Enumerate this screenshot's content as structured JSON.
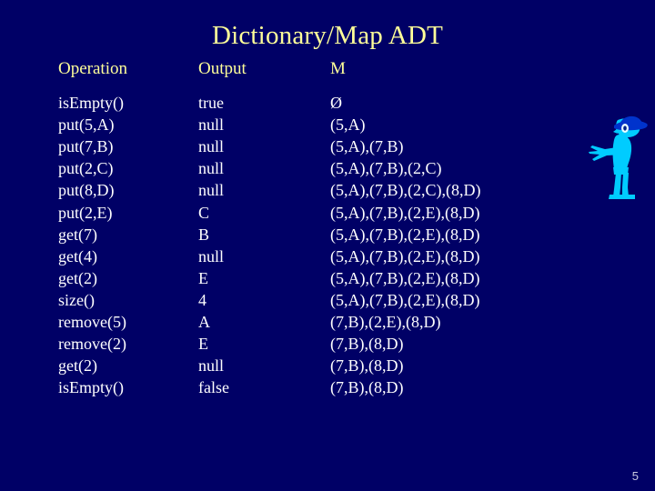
{
  "slide": {
    "title": "Dictionary/Map ADT",
    "page_number": "5",
    "background_color": "#000066",
    "title_color": "#FFFF99",
    "header_color": "#FFFF99",
    "body_color": "#FFFFFF",
    "mascot_color": "#00CCFF",
    "mascot_hat_color": "#0033CC"
  },
  "table": {
    "headers": {
      "operation": "Operation",
      "output": "Output",
      "m": "M"
    },
    "rows": [
      {
        "operation": "isEmpty()",
        "output": "true",
        "m": "Ø"
      },
      {
        "operation": "put(5,A)",
        "output": "null",
        "m": "(5,A)"
      },
      {
        "operation": "put(7,B)",
        "output": "null",
        "m": "(5,A),(7,B)"
      },
      {
        "operation": "put(2,C)",
        "output": "null",
        "m": "(5,A),(7,B),(2,C)"
      },
      {
        "operation": "put(8,D)",
        "output": "null",
        "m": "(5,A),(7,B),(2,C),(8,D)"
      },
      {
        "operation": "put(2,E)",
        "output": "C",
        "m": "(5,A),(7,B),(2,E),(8,D)"
      },
      {
        "operation": "get(7)",
        "output": "B",
        "m": "(5,A),(7,B),(2,E),(8,D)"
      },
      {
        "operation": "get(4)",
        "output": "null",
        "m": "(5,A),(7,B),(2,E),(8,D)"
      },
      {
        "operation": "get(2)",
        "output": "E",
        "m": "(5,A),(7,B),(2,E),(8,D)"
      },
      {
        "operation": "size()",
        "output": "4",
        "m": "(5,A),(7,B),(2,E),(8,D)"
      },
      {
        "operation": "remove(5)",
        "output": "A",
        "m": "(7,B),(2,E),(8,D)"
      },
      {
        "operation": "remove(2)",
        "output": "E",
        "m": "(7,B),(8,D)"
      },
      {
        "operation": "get(2)",
        "output": "null",
        "m": "(7,B),(8,D)"
      },
      {
        "operation": "isEmpty()",
        "output": "false",
        "m": "(7,B),(8,D)"
      }
    ]
  },
  "mascot": {
    "icon": "cartoon-character-pointing-icon"
  }
}
